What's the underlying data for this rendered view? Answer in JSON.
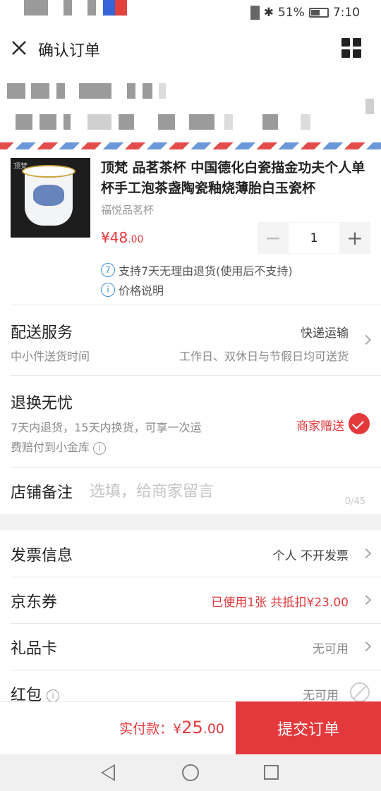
{
  "status_bar": {
    "battery": "51%",
    "battery_level": 0.51,
    "time": "7:10"
  },
  "header": {
    "title": "确认订单",
    "close_icon": "close-icon",
    "menu_icon": "grid-icon"
  },
  "product": {
    "title": "顶梵 品茗茶杯 中国德化白瓷描金功夫个人单杯手工泡茶盏陶瓷釉烧薄胎白玉瓷杯",
    "shop": "福悦品茗杯",
    "price_currency": "¥",
    "price_int": "48",
    "price_dec": ".00",
    "quantity": "1",
    "minus": "−",
    "plus": "+",
    "return_badge": "7",
    "return_policy": "支持7天无理由退货(使用后不支持)",
    "price_note_icon": "i",
    "price_note": "价格说明"
  },
  "delivery": {
    "title": "配送服务",
    "method": "快递运输",
    "sub_left": "中小件送货时间",
    "sub_right": "工作日、双休日与节假日均可送货"
  },
  "returns": {
    "title": "退换无忧",
    "desc_line1": "7天内退货，15天内换货，可享一次运",
    "desc_line2": "费赔付到小金库",
    "tag": "商家赠送",
    "checked": true
  },
  "remark": {
    "label": "店铺备注",
    "placeholder": "选填，给商家留言",
    "counter": "0/45"
  },
  "invoice": {
    "label": "发票信息",
    "value": "个人 不开发票"
  },
  "coupon": {
    "label": "京东券",
    "value": "已使用1张 共抵扣¥23.00"
  },
  "gift_card": {
    "label": "礼品卡",
    "value": "无可用"
  },
  "red_packet": {
    "label": "红包",
    "value": "无可用"
  },
  "footer": {
    "pay_label": "实付款：",
    "currency": "¥",
    "amount_int": "25",
    "amount_dec": ".00",
    "submit": "提交订单"
  },
  "colors": {
    "accent": "#e4393c",
    "info_blue": "#3e8fd8"
  }
}
